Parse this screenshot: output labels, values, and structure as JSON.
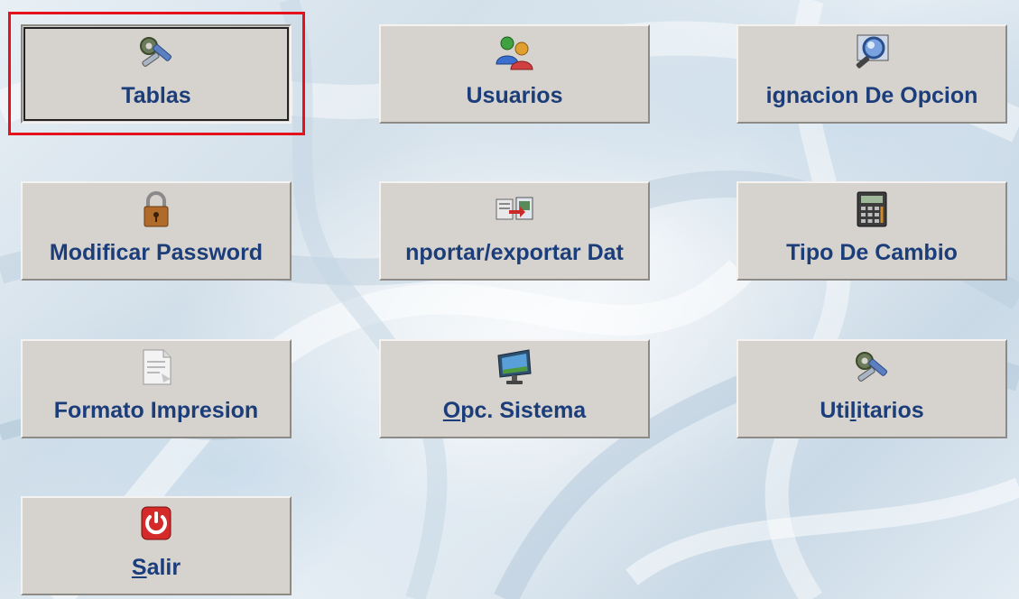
{
  "menu": {
    "buttons": [
      {
        "id": "tablas",
        "icon": "tools-icon",
        "label_pre": "",
        "label_mn": "",
        "label_post": "Tablas",
        "focused": true
      },
      {
        "id": "usuarios",
        "icon": "users-icon",
        "label_pre": "",
        "label_mn": "",
        "label_post": "Usuarios"
      },
      {
        "id": "asignacion",
        "icon": "magnifier-icon",
        "label_pre": "",
        "label_mn": "",
        "label_post": "ignacion De Opcion"
      },
      {
        "id": "password",
        "icon": "padlock-icon",
        "label_pre": "",
        "label_mn": "",
        "label_post": "Modificar Password"
      },
      {
        "id": "importar",
        "icon": "import-export-icon",
        "label_pre": "",
        "label_mn": "",
        "label_post": "nportar/exportar Dat"
      },
      {
        "id": "tipo-cambio",
        "icon": "calculator-icon",
        "label_pre": "",
        "label_mn": "",
        "label_post": "Tipo De Cambio"
      },
      {
        "id": "formato",
        "icon": "document-icon",
        "label_pre": "",
        "label_mn": "",
        "label_post": "Formato Impresion"
      },
      {
        "id": "opc-sistema",
        "icon": "monitor-icon",
        "label_pre": "",
        "label_mn": "O",
        "label_post": "pc. Sistema"
      },
      {
        "id": "utilitarios",
        "icon": "tools-icon",
        "label_pre": "Uti",
        "label_mn": "l",
        "label_post": "itarios"
      },
      {
        "id": "salir",
        "icon": "power-icon",
        "label_pre": "",
        "label_mn": "S",
        "label_post": "alir"
      }
    ]
  },
  "colors": {
    "button_face": "#d6d3ce",
    "label_text": "#1b3d7a",
    "focus_frame": "#e3121c"
  }
}
